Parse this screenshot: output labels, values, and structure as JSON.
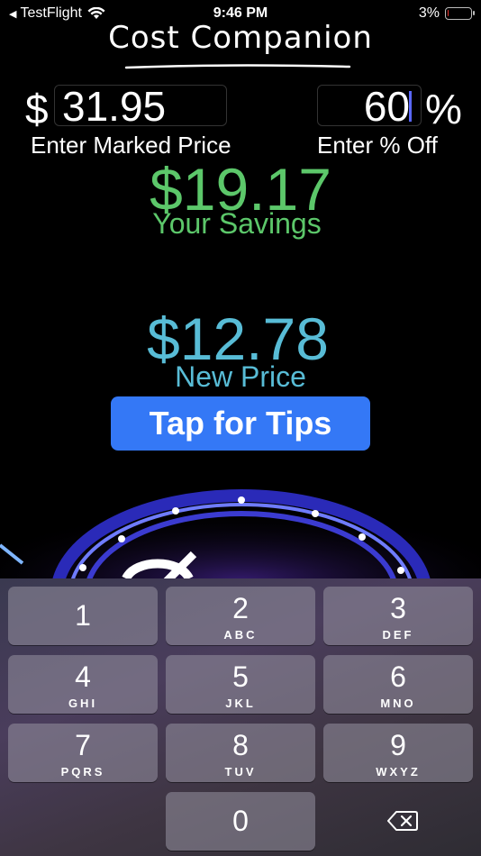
{
  "status_bar": {
    "back_app": "TestFlight",
    "time": "9:46 PM",
    "battery_percent": "3%",
    "battery_level": 0.03
  },
  "app": {
    "title": "Cost Companion"
  },
  "inputs": {
    "currency_symbol": "$",
    "price_value": "31.95",
    "price_label": "Enter Marked Price",
    "percent_value": "60",
    "percent_symbol": "%",
    "percent_label": "Enter % Off"
  },
  "results": {
    "savings_value": "$19.17",
    "savings_label": "Your Savings",
    "new_price_value": "$12.78",
    "new_price_label": "New Price"
  },
  "tips_button": {
    "label": "Tap for Tips"
  },
  "keypad": {
    "keys": [
      {
        "num": "1",
        "letters": ""
      },
      {
        "num": "2",
        "letters": "ABC"
      },
      {
        "num": "3",
        "letters": "DEF"
      },
      {
        "num": "4",
        "letters": "GHI"
      },
      {
        "num": "5",
        "letters": "JKL"
      },
      {
        "num": "6",
        "letters": "MNO"
      },
      {
        "num": "7",
        "letters": "PQRS"
      },
      {
        "num": "8",
        "letters": "TUV"
      },
      {
        "num": "9",
        "letters": "WXYZ"
      },
      {
        "num": "0",
        "letters": ""
      }
    ],
    "delete_icon": "backspace-icon"
  },
  "colors": {
    "savings": "#5cc76a",
    "new_price": "#58bcd6",
    "button": "#3478f6",
    "caret": "#5a67ff"
  }
}
